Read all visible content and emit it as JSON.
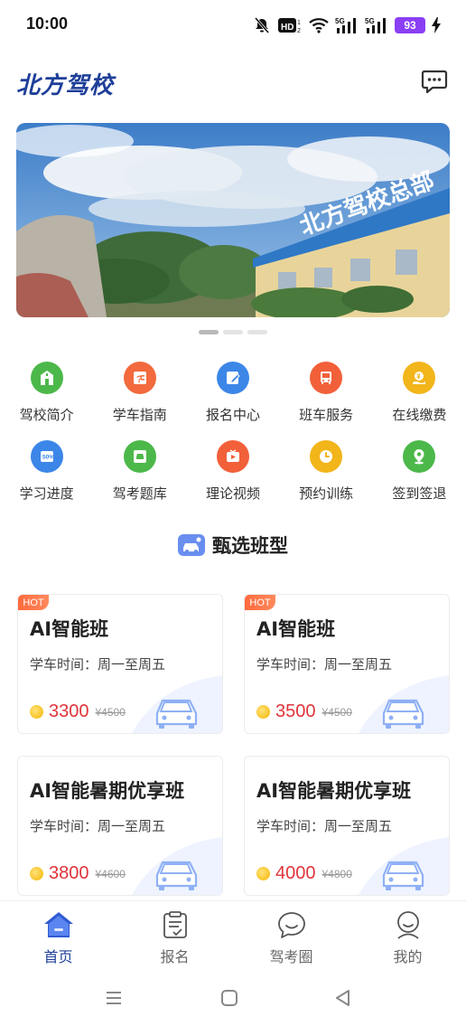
{
  "status": {
    "time": "10:00",
    "battery": "93"
  },
  "header": {
    "title": "北方驾校"
  },
  "banner": {
    "sign_text": "北方驾校总部"
  },
  "menu": {
    "row1": [
      {
        "label": "驾校简介",
        "icon": "school-icon",
        "color": "#4cb84a"
      },
      {
        "label": "学车指南",
        "icon": "guide-icon",
        "color": "#f26a3d"
      },
      {
        "label": "报名中心",
        "icon": "signup-icon",
        "color": "#3c86e8"
      },
      {
        "label": "班车服务",
        "icon": "bus-icon",
        "color": "#f2603a"
      },
      {
        "label": "在线缴费",
        "icon": "payment-icon",
        "color": "#f2b51a"
      }
    ],
    "row2": [
      {
        "label": "学习进度",
        "icon": "progress-icon",
        "color": "#3c86e8"
      },
      {
        "label": "驾考题库",
        "icon": "question-bank-icon",
        "color": "#4cb84a"
      },
      {
        "label": "理论视频",
        "icon": "video-icon",
        "color": "#f2603a"
      },
      {
        "label": "预约训练",
        "icon": "clock-icon",
        "color": "#f2b51a"
      },
      {
        "label": "签到签退",
        "icon": "location-icon",
        "color": "#4cb84a"
      }
    ]
  },
  "section": {
    "title": "甄选班型"
  },
  "courses": [
    {
      "hot": "HOT",
      "name": "AI智能班",
      "time": "学车时间：周一至周五",
      "price": "3300",
      "old_price": "¥4500"
    },
    {
      "hot": "HOT",
      "name": "AI智能班",
      "time": "学车时间：周一至周五",
      "price": "3500",
      "old_price": "¥4500"
    },
    {
      "hot": "",
      "name": "AI智能暑期优享班",
      "time": "学车时间：周一至周五",
      "price": "3800",
      "old_price": "¥4600"
    },
    {
      "hot": "",
      "name": "AI智能暑期优享班",
      "time": "学车时间：周一至周五",
      "price": "4000",
      "old_price": "¥4800"
    }
  ],
  "tabs": [
    {
      "label": "首页",
      "icon": "home-icon",
      "active": true
    },
    {
      "label": "报名",
      "icon": "clipboard-icon",
      "active": false
    },
    {
      "label": "驾考圈",
      "icon": "chat-bubble-icon",
      "active": false
    },
    {
      "label": "我的",
      "icon": "profile-icon",
      "active": false
    }
  ],
  "colors": {
    "brand": "#1e3f99",
    "price": "#e0343a"
  }
}
